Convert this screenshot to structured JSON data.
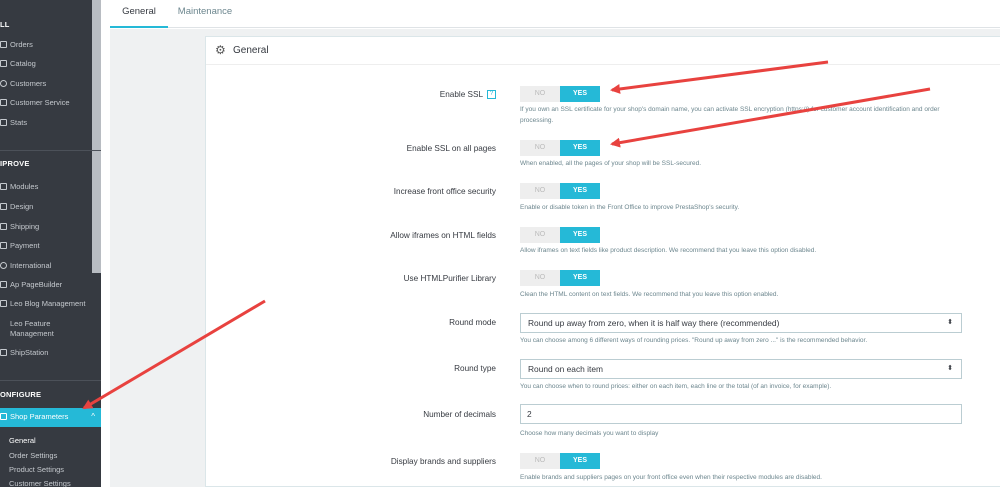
{
  "sidebar": {
    "sell_heading": "LL",
    "sell_items": [
      {
        "label": "Orders",
        "icon": "inbox-icon"
      },
      {
        "label": "Catalog",
        "icon": "store-icon"
      },
      {
        "label": "Customers",
        "icon": "account-icon"
      },
      {
        "label": "Customer Service",
        "icon": "chat-icon"
      },
      {
        "label": "Stats",
        "icon": "bar-chart-icon"
      }
    ],
    "improve_heading": "IPROVE",
    "improve_items": [
      {
        "label": "Modules",
        "icon": "puzzle-icon"
      },
      {
        "label": "Design",
        "icon": "desktop-icon"
      },
      {
        "label": "Shipping",
        "icon": "truck-icon"
      },
      {
        "label": "Payment",
        "icon": "card-icon"
      },
      {
        "label": "International",
        "icon": "globe-icon"
      },
      {
        "label": "Ap PageBuilder",
        "icon": "pagebuilder-icon"
      },
      {
        "label": "Leo Blog Management",
        "icon": "blog-icon"
      },
      {
        "label": "Leo Feature Management",
        "icon": "feature-icon"
      },
      {
        "label": "ShipStation",
        "icon": "shipstation-icon"
      }
    ],
    "configure_heading": "ONFIGURE",
    "active_item": {
      "label": "Shop Parameters",
      "icon": "settings-icon",
      "chevron": "^"
    },
    "sub_items": [
      {
        "label": "General",
        "current": true
      },
      {
        "label": "Order Settings",
        "current": false
      },
      {
        "label": "Product Settings",
        "current": false
      },
      {
        "label": "Customer Settings",
        "current": false
      }
    ]
  },
  "tabs": [
    {
      "label": "General",
      "active": true
    },
    {
      "label": "Maintenance",
      "active": false
    }
  ],
  "panel": {
    "title": "General",
    "icon": "gear-icon"
  },
  "switch_labels": {
    "no": "NO",
    "yes": "YES"
  },
  "settings": {
    "enable_ssl": {
      "label": "Enable SSL",
      "help_badge": "?",
      "value": "YES",
      "help": "If you own an SSL certificate for your shop's domain name, you can activate SSL encryption (https://) for customer account identification and order processing."
    },
    "enable_ssl_all": {
      "label": "Enable SSL on all pages",
      "value": "YES",
      "help": "When enabled, all the pages of your shop will be SSL-secured."
    },
    "front_security": {
      "label": "Increase front office security",
      "value": "YES",
      "help": "Enable or disable token in the Front Office to improve PrestaShop's security."
    },
    "iframes": {
      "label": "Allow iframes on HTML fields",
      "value": "YES",
      "help": "Allow iframes on text fields like product description. We recommend that you leave this option disabled."
    },
    "htmlpurifier": {
      "label": "Use HTMLPurifier Library",
      "value": "YES",
      "help": "Clean the HTML content on text fields. We recommend that you leave this option enabled."
    },
    "round_mode": {
      "label": "Round mode",
      "value": "Round up away from zero, when it is half way there (recommended)",
      "help": "You can choose among 6 different ways of rounding prices. \"Round up away from zero ...\" is the recommended behavior."
    },
    "round_type": {
      "label": "Round type",
      "value": "Round on each item",
      "help": "You can choose when to round prices: either on each item, each line or the total (of an invoice, for example)."
    },
    "decimals": {
      "label": "Number of decimals",
      "value": "2",
      "help": "Choose how many decimals you want to display"
    },
    "brands_suppliers": {
      "label": "Display brands and suppliers",
      "value": "YES",
      "help": "Enable brands and suppliers pages on your front office even when their respective modules are disabled."
    }
  },
  "select_arrow": "⬍",
  "colors": {
    "accent": "#25b9d7",
    "sidebar_bg": "#363a41",
    "annotation_arrow": "#e8423f"
  }
}
